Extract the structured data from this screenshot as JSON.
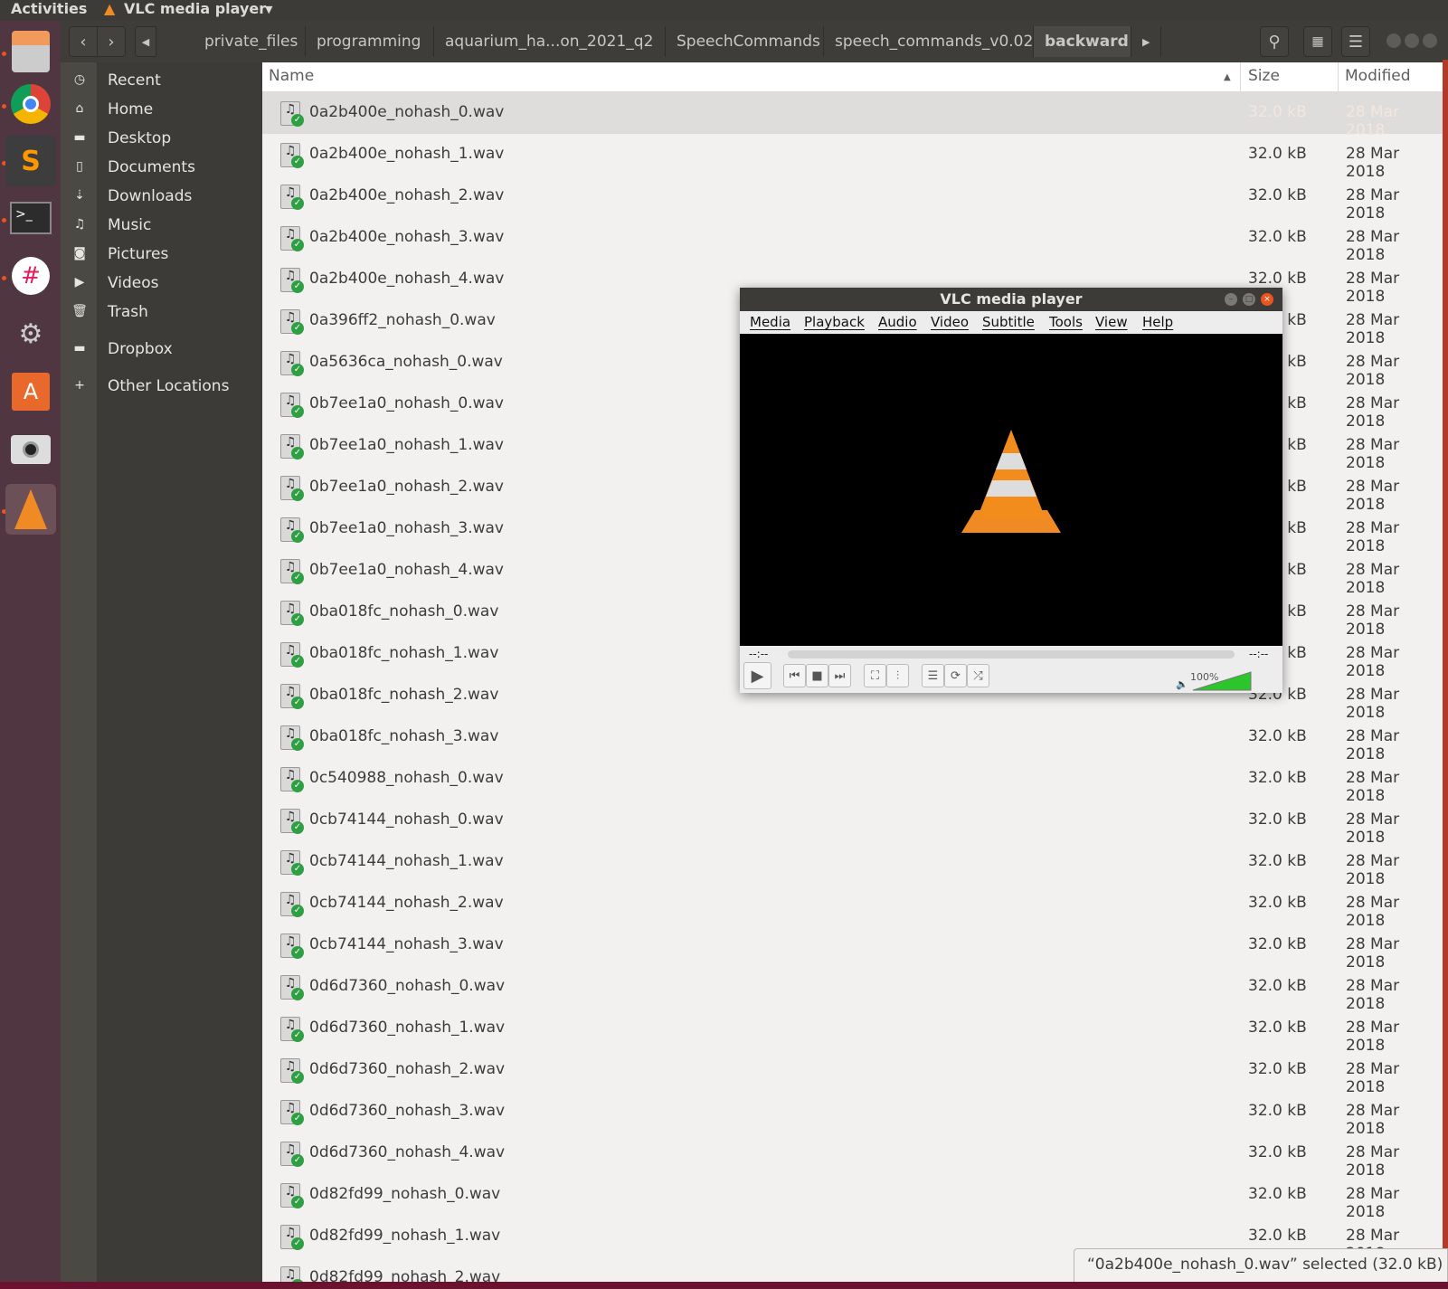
{
  "topbar": {
    "activities": "Activities",
    "app_menu": "VLC media player"
  },
  "dock": {
    "apps": [
      "files",
      "chrome",
      "sublime-text",
      "terminal",
      "slack",
      "system-tools",
      "software-center",
      "camera",
      "vlc"
    ]
  },
  "header": {
    "breadcrumbs": [
      "private_files",
      "programming",
      "aquarium_ha...on_2021_q2",
      "SpeechCommands",
      "speech_commands_v0.02",
      "backward"
    ],
    "current": "backward"
  },
  "sidebar": {
    "items": [
      {
        "label": "Recent",
        "icon": "clock-icon"
      },
      {
        "label": "Home",
        "icon": "home-icon"
      },
      {
        "label": "Desktop",
        "icon": "folder-icon"
      },
      {
        "label": "Documents",
        "icon": "document-icon"
      },
      {
        "label": "Downloads",
        "icon": "download-icon"
      },
      {
        "label": "Music",
        "icon": "music-icon"
      },
      {
        "label": "Pictures",
        "icon": "camera-icon"
      },
      {
        "label": "Videos",
        "icon": "video-icon"
      },
      {
        "label": "Trash",
        "icon": "trash-icon"
      },
      {
        "label": "Dropbox",
        "icon": "folder-icon"
      },
      {
        "label": "Other Locations",
        "icon": "plus-icon"
      }
    ]
  },
  "columns": {
    "name": "Name",
    "size": "Size",
    "modified": "Modified"
  },
  "files": [
    "0a2b400e_nohash_0.wav",
    "0a2b400e_nohash_1.wav",
    "0a2b400e_nohash_2.wav",
    "0a2b400e_nohash_3.wav",
    "0a2b400e_nohash_4.wav",
    "0a396ff2_nohash_0.wav",
    "0a5636ca_nohash_0.wav",
    "0b7ee1a0_nohash_0.wav",
    "0b7ee1a0_nohash_1.wav",
    "0b7ee1a0_nohash_2.wav",
    "0b7ee1a0_nohash_3.wav",
    "0b7ee1a0_nohash_4.wav",
    "0ba018fc_nohash_0.wav",
    "0ba018fc_nohash_1.wav",
    "0ba018fc_nohash_2.wav",
    "0ba018fc_nohash_3.wav",
    "0c540988_nohash_0.wav",
    "0cb74144_nohash_0.wav",
    "0cb74144_nohash_1.wav",
    "0cb74144_nohash_2.wav",
    "0cb74144_nohash_3.wav",
    "0d6d7360_nohash_0.wav",
    "0d6d7360_nohash_1.wav",
    "0d6d7360_nohash_2.wav",
    "0d6d7360_nohash_3.wav",
    "0d6d7360_nohash_4.wav",
    "0d82fd99_nohash_0.wav",
    "0d82fd99_nohash_1.wav",
    "0d82fd99_nohash_2.wav"
  ],
  "file_size": "32.0 kB",
  "file_modified": "28 Mar 2018",
  "selected_index": 0,
  "status": "“0a2b400e_nohash_0.wav” selected  (32.0 kB)",
  "vlc": {
    "title": "VLC media player",
    "menu": [
      "Media",
      "Playback",
      "Audio",
      "Video",
      "Subtitle",
      "Tools",
      "View",
      "Help"
    ],
    "elapsed": "--:--",
    "remaining": "--:--",
    "volume_label": "100%",
    "volume": 1.0
  }
}
